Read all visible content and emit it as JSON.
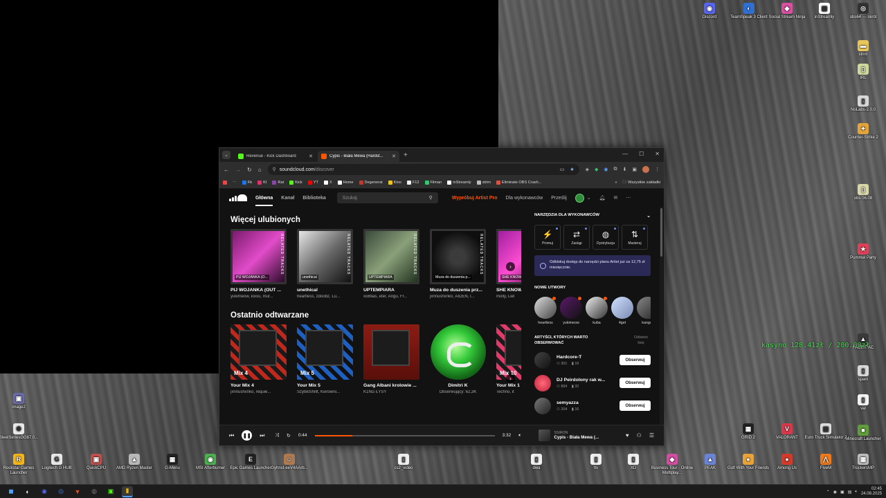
{
  "desktop": {
    "icons_right": [
      {
        "label": "Discord",
        "color": "#5865f2",
        "glyph": "◉"
      },
      {
        "label": "TeamSpeak 3 Client",
        "color": "#2f6fd1",
        "glyph": "◐"
      },
      {
        "label": "Social Stream Ninja",
        "color": "#d94fa1",
        "glyph": "◆"
      },
      {
        "label": "inStreamly",
        "color": "#ffffff",
        "glyph": "▦"
      },
      {
        "label": "obs64 — skrót",
        "color": "#333333",
        "glyph": "◎"
      }
    ],
    "icons_col": [
      {
        "label": "strim",
        "color": "#e8c65a",
        "glyph": "▬"
      },
      {
        "label": "IRL",
        "color": "#cfd89a",
        "glyph": "▯"
      },
      {
        "label": "NoLabs-2.0.0",
        "color": "#d8d8d8",
        "glyph": "▯"
      },
      {
        "label": "Counter-Strike 2",
        "color": "#e3a43a",
        "glyph": "✦"
      },
      {
        "label": "obs 06.08",
        "color": "#d9d7a8",
        "glyph": "▯"
      },
      {
        "label": "Pummel Party",
        "color": "#e04058",
        "glyph": "★"
      },
      {
        "label": "FACEIT AC",
        "color": "#3a3a3a",
        "glyph": "▲"
      },
      {
        "label": "spam",
        "color": "#d8d8d8",
        "glyph": "▯"
      },
      {
        "label": "val",
        "color": "#f3f3f3",
        "glyph": "▯"
      },
      {
        "label": "Minecraft Launcher",
        "color": "#5f9e3a",
        "glyph": "■"
      }
    ],
    "icons_left": [
      {
        "label": "image2",
        "color": "#6a6aa8",
        "glyph": "▣"
      },
      {
        "label": "SteelSeriesGG87.0...",
        "color": "#e9e9e9",
        "glyph": "⚙"
      }
    ],
    "icons_bottom": [
      {
        "label": "Rockstar Games Launcher",
        "color": "#f4b51b",
        "glyph": "R"
      },
      {
        "label": "Logitech G HUB",
        "color": "#e8e8e8",
        "glyph": "G"
      },
      {
        "label": "QuickCPU",
        "color": "#c0504d",
        "glyph": "▣"
      },
      {
        "label": "AMD Ryzen Master",
        "color": "#b8b8b8",
        "glyph": "▲"
      },
      {
        "label": "G-Menu",
        "color": "#222222",
        "glyph": "▦"
      },
      {
        "label": "MSI Afterburner",
        "color": "#4caf50",
        "glyph": "◉"
      },
      {
        "label": "Epic Games Launcher",
        "color": "#222222",
        "glyph": "E"
      },
      {
        "label": "Gyhnst-eeV4AArb...",
        "color": "#b07a50",
        "glyph": "☺"
      },
      {
        "label": "cs2_video",
        "color": "#f0f0f0",
        "glyph": "▯"
      },
      {
        "label": "dwa",
        "color": "#f0f0f0",
        "glyph": "▯"
      },
      {
        "label": "ttv",
        "color": "#f0f0f0",
        "glyph": "▯"
      },
      {
        "label": "XD",
        "color": "#f0f0f0",
        "glyph": "▯"
      },
      {
        "label": "Business Tour - Online Multiplay...",
        "color": "#d24ea0",
        "glyph": "◆"
      },
      {
        "label": "PEAK",
        "color": "#6b84d6",
        "glyph": "▲"
      },
      {
        "label": "Golf With Your Friends",
        "color": "#e8a23a",
        "glyph": "●"
      },
      {
        "label": "Among Us",
        "color": "#d23a2a",
        "glyph": "●"
      },
      {
        "label": "FiveM",
        "color": "#f07a1a",
        "glyph": "⋀"
      },
      {
        "label": "TruckersMP",
        "color": "#bcbcbc",
        "glyph": "▦"
      }
    ],
    "icons_bottom2": [
      {
        "label": "GRID 2",
        "color": "#222222",
        "glyph": "▦"
      },
      {
        "label": "VALORANT",
        "color": "#d8384a",
        "glyph": "V"
      },
      {
        "label": "Euro Truck Simulator 2",
        "color": "#dddddd",
        "glyph": "▦"
      }
    ],
    "overlay_text": "kasyno 128.41zł / 200.00zł"
  },
  "taskbar": {
    "icons": [
      "◼",
      "◐",
      "◉",
      "◎",
      "▼",
      "◍",
      "▣",
      "▮"
    ],
    "clock_time": "02:45",
    "clock_date": "24.08.2025"
  },
  "browser": {
    "tabs": [
      {
        "title": "Revenue - Kick Dashboard",
        "color": "#53fc18"
      },
      {
        "title": "Cypis - Biała Mewa (Hardst...",
        "color": "#ff5500"
      }
    ],
    "url_host": "soundcloud.com",
    "url_path": "/discover",
    "bookmarks": [
      {
        "label": "Fb",
        "color": "#1877f2"
      },
      {
        "label": "KI",
        "color": "#e1306c"
      },
      {
        "label": "Rat",
        "color": "#8e44ad"
      },
      {
        "label": "Kick",
        "color": "#53fc18"
      },
      {
        "label": "YT",
        "color": "#ff0000"
      },
      {
        "label": "X",
        "color": "#ffffff"
      },
      {
        "label": "Home",
        "color": "#ffffff"
      },
      {
        "label": "Degenerat",
        "color": "#c0392b"
      },
      {
        "label": "Kino",
        "color": "#f1c40f"
      },
      {
        "label": "F12",
        "color": "#eeeeee"
      },
      {
        "label": "Filman",
        "color": "#2ecc71"
      },
      {
        "label": "inStreamly",
        "color": "#ffffff"
      },
      {
        "label": "strim",
        "color": "#bbbbbb"
      },
      {
        "label": "Eliminate OBS Crash...",
        "color": "#e74c3c"
      }
    ],
    "bookmarks_folder": "Wszystkie zakładki"
  },
  "soundcloud": {
    "nav": {
      "home": "Główna",
      "feed": "Kanał",
      "library": "Biblioteka",
      "search_placeholder": "Szukaj",
      "artist_pro": "Wypróbuj Artist Pro",
      "for_artists": "Dla wykonawców",
      "upload": "Prześlij"
    },
    "more_of_what_you_like": {
      "title": "Więcej ulubionych",
      "related_tag": "RELATED TRACKS",
      "items": [
        {
          "caption": "PIJ WOJANKA (O...",
          "title": "PIJ WOJANKA (OUT ...",
          "artists": "yukimeow, kixxu, mur...",
          "bg": "linear-gradient(135deg,#7b1a6e,#e24cc9 50%,#2a0b28)"
        },
        {
          "caption": "unethical",
          "title": "unethical",
          "artists": "heartless, zdoobz, Lu...",
          "bg": "linear-gradient(135deg,#e6e6e6,#6a6a6a 50%,#111)"
        },
        {
          "caption": "UPTEMPIARA",
          "title": "UPTEMPIARA",
          "artists": "xoBlias, eter, Angu, Fr...",
          "bg": "linear-gradient(135deg,#3a4a3a,#8aa07a 50%,#22331f)"
        },
        {
          "caption": "Muza do duszenia p...",
          "title": "Muza do duszenia prz...",
          "artists": "jxnnushxnko, AIDEN, I...",
          "bg": "radial-gradient(circle,#3b3b3b 20%,#0e0e0e 70%)"
        },
        {
          "caption": "SHE KNOW",
          "title": "SHE KNOW",
          "artists": "molly, Liel",
          "bg": "linear-gradient(135deg,#a020a0,#ff4dd2 50%,#300030)"
        }
      ]
    },
    "recently_played": {
      "title": "Ostatnio odtwarzane",
      "items": [
        {
          "mix": "Mix 4",
          "title": "Your Mix 4",
          "artists": "jxnnushxnko, requie...",
          "bg": "repeating-linear-gradient(45deg,#c0281c 0 6px,#1a1a1a 6px 12px)"
        },
        {
          "mix": "Mix 5",
          "title": "Your Mix 5",
          "artists": "SzybkiShillt, Kierowni...",
          "bg": "repeating-linear-gradient(45deg,#1e5fc2 0 6px,#111 6px 12px)"
        },
        {
          "mix": "",
          "title": "Gang Albani krolowie ...",
          "artists": "K1NG ŁYSY",
          "bg": "linear-gradient(180deg,#8c1c14,#5a0f0a)"
        },
        {
          "mix": "",
          "title": "Dimitri K",
          "artists": "Obserwujący: 62,3K",
          "bg": ""
        },
        {
          "mix": "Mix 10",
          "title": "Your Mix 1",
          "artists": "Techno, it",
          "bg": "repeating-linear-gradient(45deg,#e23a6a 0 6px,#1a1a1a 6px 12px)"
        }
      ]
    },
    "sidebar": {
      "tools_title": "NARZĘDZIA DLA WYKONAWCÓW",
      "tools": [
        {
          "label": "Promuj",
          "glyph": "⚡"
        },
        {
          "label": "Zastąp",
          "glyph": "⇄"
        },
        {
          "label": "Dystrybucja",
          "glyph": "◍"
        },
        {
          "label": "Masteruj",
          "glyph": "⇅"
        }
      ],
      "promo_text": "Odblokuj dostęp do narzędzi planu Artist już za 12,75 zł miesięcznie.",
      "new_tracks_title": "NOWE UTWORY",
      "new_tracks": [
        {
          "name": "heartless",
          "bg": "linear-gradient(135deg,#ddd,#444)"
        },
        {
          "name": "yukimeow",
          "bg": "linear-gradient(135deg,#5a1a6a,#111)"
        },
        {
          "name": "kuba",
          "bg": "linear-gradient(135deg,#eee,#333)"
        },
        {
          "name": "4get",
          "bg": "linear-gradient(135deg,#cfe0ff,#7a8ab0)"
        },
        {
          "name": "kangun",
          "bg": "linear-gradient(135deg,#888,#222)"
        }
      ],
      "follow_title": "ARTYŚCI, KTÓRYCH WARTO OBSERWOWAĆ",
      "refresh": "Odśwież listę",
      "follow_label": "Obserwuj",
      "artists": [
        {
          "name": "Hardcore-T",
          "followers": "301",
          "tracks": "19",
          "bg": "linear-gradient(135deg,#444,#111)"
        },
        {
          "name": "DJ Peirdolony rak w...",
          "followers": "894",
          "tracks": "32",
          "bg": "radial-gradient(circle,#ff6a7a,#c0203a)"
        },
        {
          "name": "semyazza",
          "followers": "204",
          "tracks": "16",
          "bg": "linear-gradient(135deg,#777,#222)"
        }
      ]
    },
    "player": {
      "current_time": "0:44",
      "total_time": "3:32",
      "progress": 0.21,
      "artist": "SSIRON",
      "track": "Cypis - Biała Mewa (..."
    }
  }
}
